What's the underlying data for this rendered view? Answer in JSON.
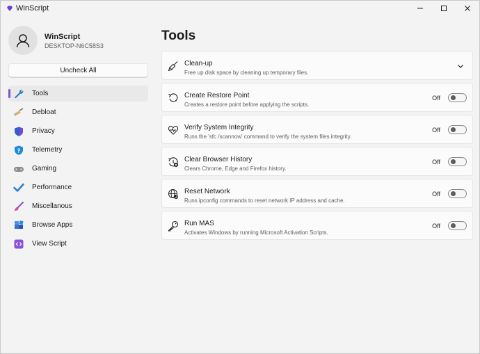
{
  "window": {
    "title": "WinScript",
    "controls": [
      "minimize-icon",
      "maximize-icon",
      "close-icon"
    ]
  },
  "profile": {
    "name": "WinScript",
    "device": "DESKTOP-N6C58S3"
  },
  "sidebar": {
    "uncheck_all_label": "Uncheck All",
    "items": [
      {
        "label": "Tools",
        "icon": "wrench-icon",
        "active": true
      },
      {
        "label": "Debloat",
        "icon": "broom-icon"
      },
      {
        "label": "Privacy",
        "icon": "shield-icon"
      },
      {
        "label": "Telemetry",
        "icon": "shield-question-icon"
      },
      {
        "label": "Gaming",
        "icon": "gamepad-icon"
      },
      {
        "label": "Performance",
        "icon": "checkmark-icon"
      },
      {
        "label": "Miscellanous",
        "icon": "paintbrush-icon"
      },
      {
        "label": "Browse Apps",
        "icon": "apps-icon"
      },
      {
        "label": "View Script",
        "icon": "code-icon"
      }
    ]
  },
  "main": {
    "title": "Tools",
    "cards": [
      {
        "title": "Clean-up",
        "description": "Free up disk space by cleaning up temporary files.",
        "icon": "broom-icon",
        "expandable": true
      },
      {
        "title": "Create Restore Point",
        "description": "Creates a restore point before applying the scripts.",
        "icon": "undo-icon",
        "state": "Off"
      },
      {
        "title": "Verify System Integrity",
        "description": "Runs the 'sfc /scannow' command to verify the system files integrity.",
        "icon": "heart-pulse-icon",
        "state": "Off"
      },
      {
        "title": "Clear Browser History",
        "description": "Clears Chrome, Edge and Firefox history.",
        "icon": "history-clear-icon",
        "state": "Off"
      },
      {
        "title": "Reset Network",
        "description": "Runs ipconfig commands to reset network IP address and cache.",
        "icon": "globe-reset-icon",
        "state": "Off"
      },
      {
        "title": "Run MAS",
        "description": "Activates Windows by running Microsoft Activation Scripts.",
        "icon": "key-icon",
        "state": "Off"
      }
    ]
  },
  "colors": {
    "accent": "#7a57c8",
    "background": "#f3f3f3",
    "card": "#fbfbfb"
  }
}
